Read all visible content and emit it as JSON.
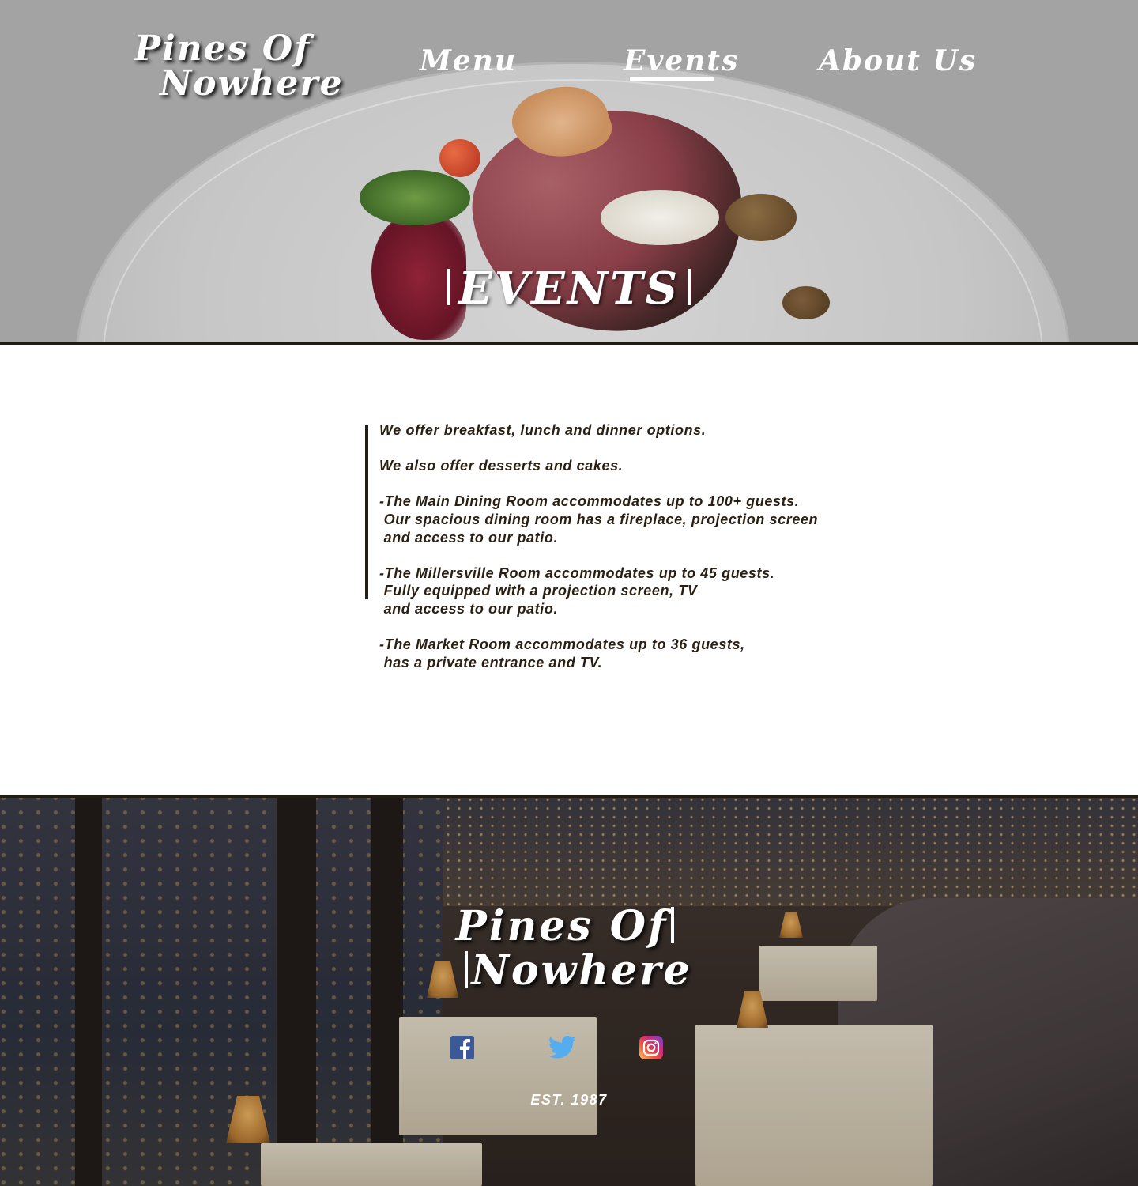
{
  "header": {
    "logo_line1": "Pines Of",
    "logo_line2": "Nowhere",
    "nav": {
      "menu": "Menu",
      "events": "Events",
      "about": "About Us"
    },
    "active_nav": "events"
  },
  "hero": {
    "title": "EVENTS"
  },
  "content": {
    "text": "We offer breakfast, lunch and dinner options.\n\nWe also offer desserts and cakes.\n\n-The Main Dining Room accommodates up to 100+ guests.\n Our spacious dining room has a fireplace, projection screen\n and access to our patio.\n\n-The Millersville Room accommodates up to 45 guests.\n Fully equipped with a projection screen, TV\n and access to our patio.\n\n-The Market Room accommodates up to 36 guests,\n has a private entrance and TV."
  },
  "footer": {
    "logo_line1": "Pines Of",
    "logo_line2": "Nowhere",
    "social": [
      "facebook-icon",
      "twitter-icon",
      "instagram-icon"
    ],
    "est": "EST. 1987"
  },
  "colors": {
    "accent_dark": "#231c12",
    "body_text": "#2a1f12",
    "hero_overlay": "#a3a3a3"
  }
}
